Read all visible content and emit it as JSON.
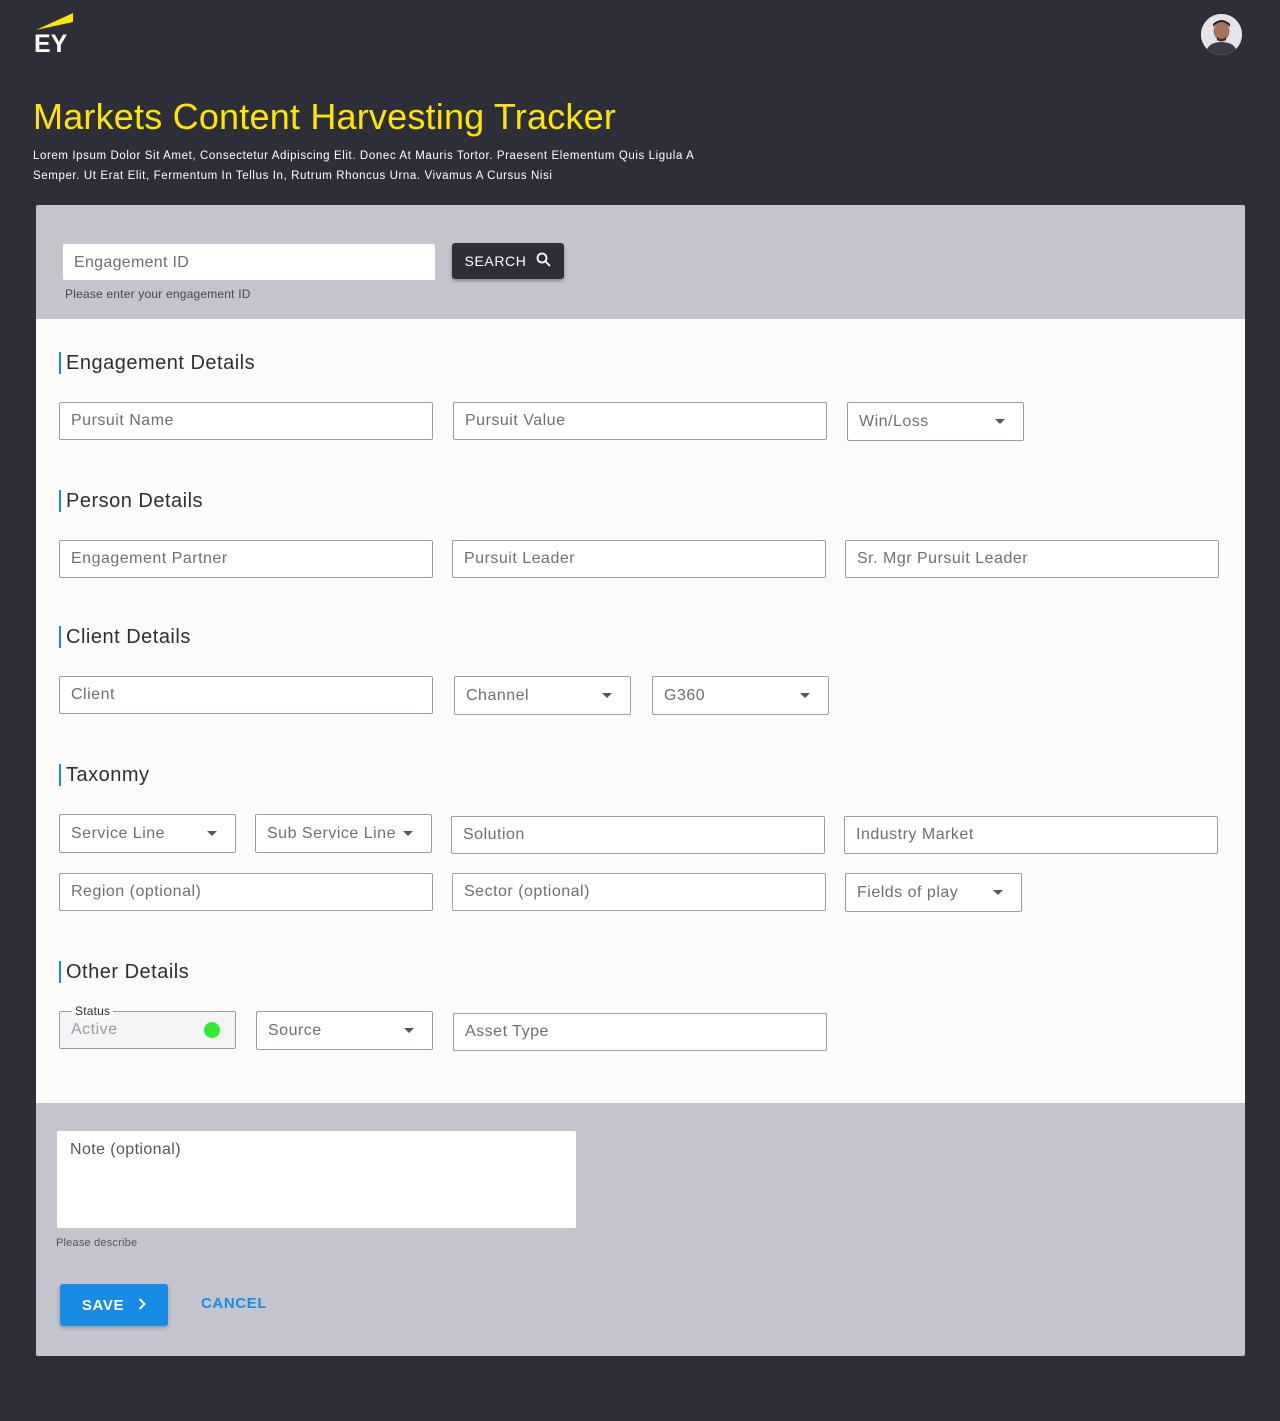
{
  "header": {
    "logo_text": "EY",
    "title": "Markets Content Harvesting Tracker",
    "subtitle": "Lorem Ipsum Dolor Sit Amet, Consectetur Adipiscing Elit. Donec At Mauris Tortor. Praesent Elementum Quis Ligula A Semper. Ut Erat Elit, Fermentum In Tellus In, Rutrum Rhoncus Urna. Vivamus A Cursus Nisi"
  },
  "search": {
    "placeholder": "Engagement ID",
    "helper": "Please enter your engagement ID",
    "button_label": "SEARCH"
  },
  "sections": {
    "engagement": {
      "title": "Engagement Details",
      "pursuit_name": "Pursuit Name",
      "pursuit_value": "Pursuit Value",
      "win_loss": "Win/Loss"
    },
    "person": {
      "title": "Person Details",
      "engagement_partner": "Engagement Partner",
      "pursuit_leader": "Pursuit Leader",
      "sr_mgr_pursuit_leader": "Sr. Mgr Pursuit Leader"
    },
    "client": {
      "title": "Client Details",
      "client": "Client",
      "channel": "Channel",
      "g360": "G360"
    },
    "taxonomy": {
      "title": "Taxonmy",
      "service_line": "Service Line",
      "sub_service_line": "Sub Service Line",
      "solution": "Solution",
      "industry_market": "Industry Market",
      "region": "Region (optional)",
      "sector": "Sector (optional)",
      "fields_of_play": "Fields of play"
    },
    "other": {
      "title": "Other Details",
      "status_label": "Status",
      "status_value": "Active",
      "source": "Source",
      "asset_type": "Asset Type"
    }
  },
  "note": {
    "placeholder": "Note (optional)",
    "helper": "Please describe"
  },
  "actions": {
    "save_label": "SAVE",
    "cancel_label": "CANCEL"
  },
  "colors": {
    "brand_yellow": "#ffe600",
    "background": "#2e2e38",
    "accent_blue": "#188ce5",
    "status_active": "#2ded2d"
  }
}
